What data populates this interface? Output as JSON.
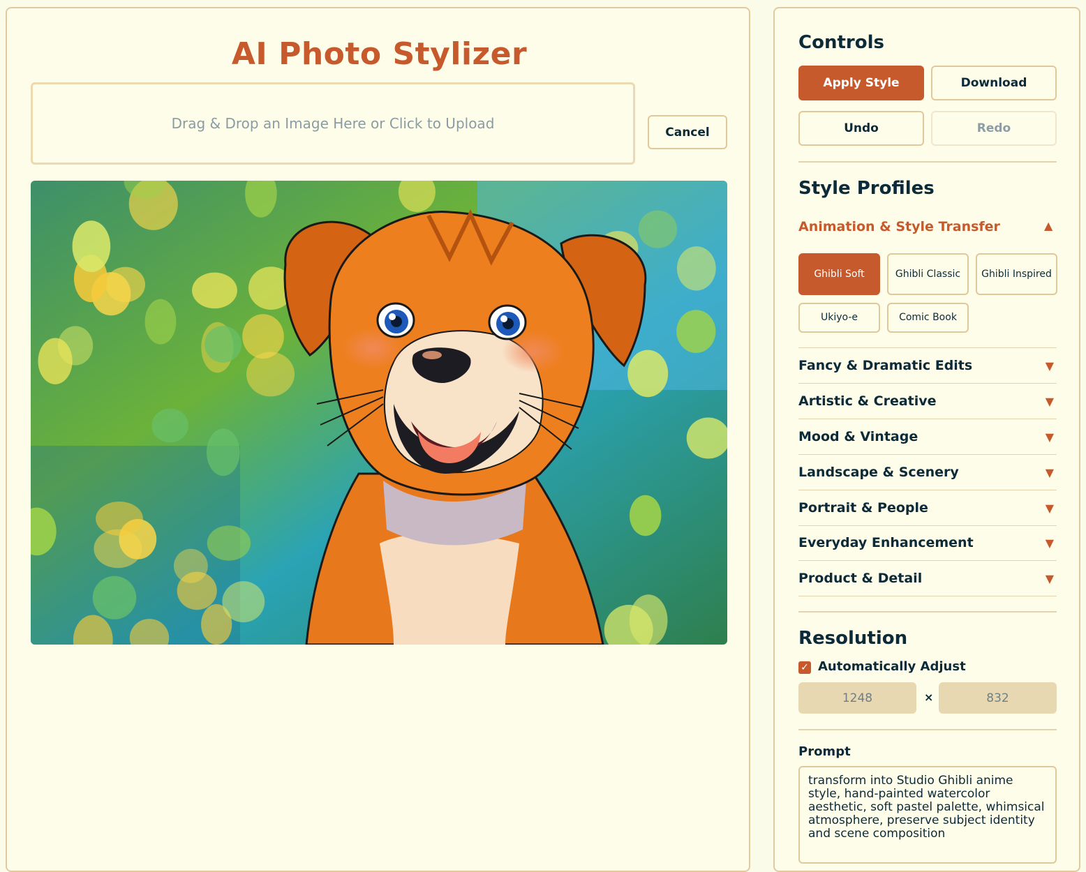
{
  "app": {
    "title": "AI Photo Stylizer"
  },
  "upload": {
    "dropzone_text": "Drag & Drop an Image Here or Click to Upload",
    "cancel_label": "Cancel"
  },
  "preview": {
    "subject": "cartoon puppy with bokeh background"
  },
  "controls": {
    "title": "Controls",
    "apply_label": "Apply Style",
    "download_label": "Download",
    "undo_label": "Undo",
    "redo_label": "Redo"
  },
  "style_profiles": {
    "title": "Style Profiles",
    "active_category": {
      "label": "Animation & Style Transfer",
      "arrow": "▲"
    },
    "chips": [
      {
        "label": "Ghibli Soft",
        "active": true
      },
      {
        "label": "Ghibli Classic",
        "active": false
      },
      {
        "label": "Ghibli Inspired",
        "active": false
      },
      {
        "label": "Ukiyo-e",
        "active": false
      },
      {
        "label": "Comic Book",
        "active": false
      }
    ],
    "categories": [
      {
        "label": "Fancy & Dramatic Edits",
        "arrow": "▼"
      },
      {
        "label": "Artistic & Creative",
        "arrow": "▼"
      },
      {
        "label": "Mood & Vintage",
        "arrow": "▼"
      },
      {
        "label": "Landscape & Scenery",
        "arrow": "▼"
      },
      {
        "label": "Portrait & People",
        "arrow": "▼"
      },
      {
        "label": "Everyday Enhancement",
        "arrow": "▼"
      },
      {
        "label": "Product & Detail",
        "arrow": "▼"
      }
    ]
  },
  "resolution": {
    "title": "Resolution",
    "auto_adjust_label": "Automatically Adjust",
    "auto_adjust_checked": true,
    "width": "1248",
    "height": "832",
    "separator": "×"
  },
  "prompt": {
    "label": "Prompt",
    "text": "transform into Studio Ghibli anime style, hand-painted watercolor aesthetic, soft pastel palette, whimsical atmosphere, preserve subject identity and scene composition"
  },
  "colors": {
    "accent": "#c75a2c",
    "background": "#fbfbe9",
    "border": "#e3c99e",
    "text": "#0d2a38"
  }
}
